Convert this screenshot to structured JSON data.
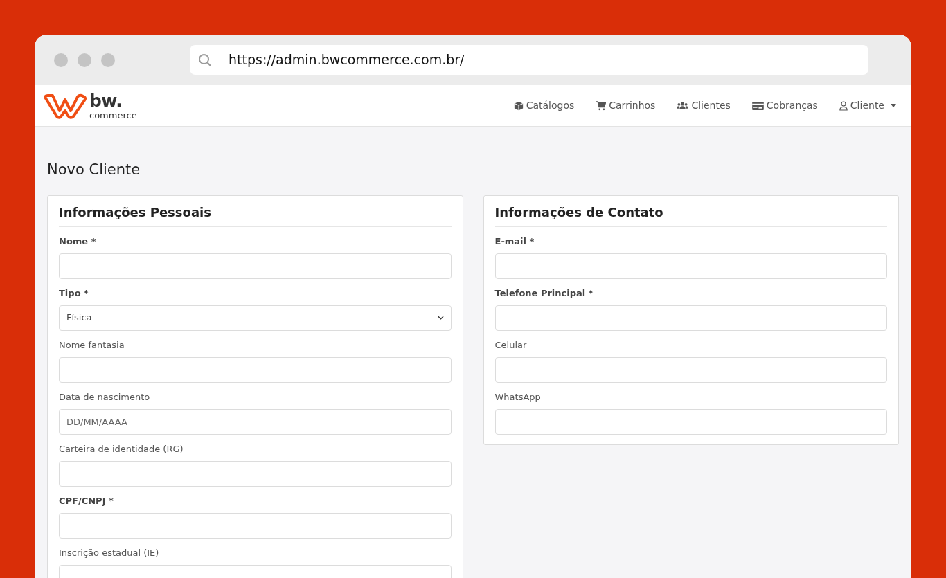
{
  "browser": {
    "url": "https://admin.bwcommerce.com.br/"
  },
  "logo": {
    "name": "bw.",
    "tagline": "commerce"
  },
  "nav": [
    {
      "label": "Catálogos",
      "dropdown": false
    },
    {
      "label": "Carrinhos",
      "dropdown": false
    },
    {
      "label": "Clientes",
      "dropdown": false
    },
    {
      "label": "Cobranças",
      "dropdown": false
    },
    {
      "label": "Cliente",
      "dropdown": true
    }
  ],
  "page_title": "Novo Cliente",
  "cards": [
    {
      "title": "Informações Pessoais",
      "fields": [
        {
          "label": "Nome *",
          "required": true,
          "kind": "input"
        },
        {
          "label": "Tipo *",
          "required": true,
          "kind": "select",
          "value": "Física"
        },
        {
          "label": "Nome fantasia",
          "required": false,
          "kind": "input"
        },
        {
          "label": "Data de nascimento",
          "required": false,
          "kind": "input",
          "placeholder": "DD/MM/AAAA"
        },
        {
          "label": "Carteira de identidade (RG)",
          "required": false,
          "kind": "input"
        },
        {
          "label": "CPF/CNPJ *",
          "required": true,
          "kind": "input"
        },
        {
          "label": "Inscrição estadual (IE)",
          "required": false,
          "kind": "input"
        }
      ]
    },
    {
      "title": "Informações de Contato",
      "fields": [
        {
          "label": "E-mail *",
          "required": true,
          "kind": "input"
        },
        {
          "label": "Telefone Principal *",
          "required": true,
          "kind": "input"
        },
        {
          "label": "Celular",
          "required": false,
          "kind": "input"
        },
        {
          "label": "WhatsApp",
          "required": false,
          "kind": "input"
        }
      ]
    }
  ]
}
